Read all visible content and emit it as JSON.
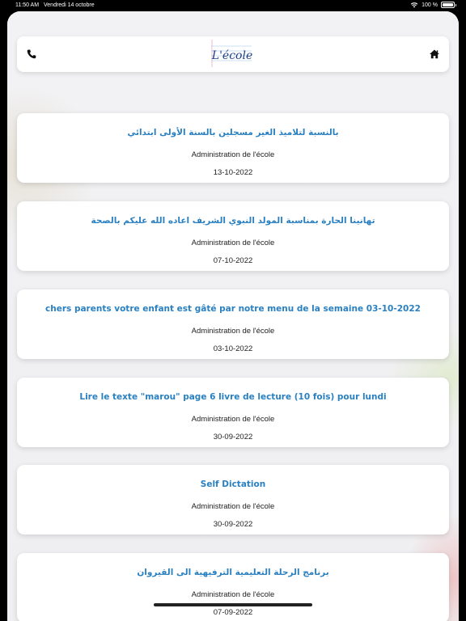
{
  "status_bar": {
    "time": "11:50 AM",
    "date": "Vendredi 14 octobre",
    "battery": "100 %",
    "battery_level": 1.0
  },
  "header": {
    "logo_text": "L'école",
    "left_icon": "phone-icon",
    "right_icon": "home-icon"
  },
  "announcements": [
    {
      "title": "بالنسبة لتلاميذ الغير مسجلين بالسنة الأولى ابتدائي",
      "author": "Administration de l'école",
      "date": "13-10-2022"
    },
    {
      "title": "تهانينا الحارة بمناسبة المولد النبوي الشريف اعاده الله عليكم بالصحة",
      "author": "Administration de l'école",
      "date": "07-10-2022"
    },
    {
      "title": "chers parents votre enfant est gâté par notre menu de la semaine 03-10-2022",
      "author": "Administration de l'école",
      "date": "03-10-2022"
    },
    {
      "title": "Lire le texte \"marou\" page 6 livre de lecture (10 fois) pour lundi",
      "author": "Administration de l'école",
      "date": "30-09-2022"
    },
    {
      "title": "Self Dictation",
      "author": "Administration de l'école",
      "date": "30-09-2022"
    },
    {
      "title": "برنامج الرحلة التعليمية الترفيهية الى القيروان",
      "author": "Administration de l'école",
      "date": "07-09-2022"
    }
  ],
  "colors": {
    "title": "#2a80c0",
    "background": "#f1f1f3",
    "card": "#ffffff"
  }
}
